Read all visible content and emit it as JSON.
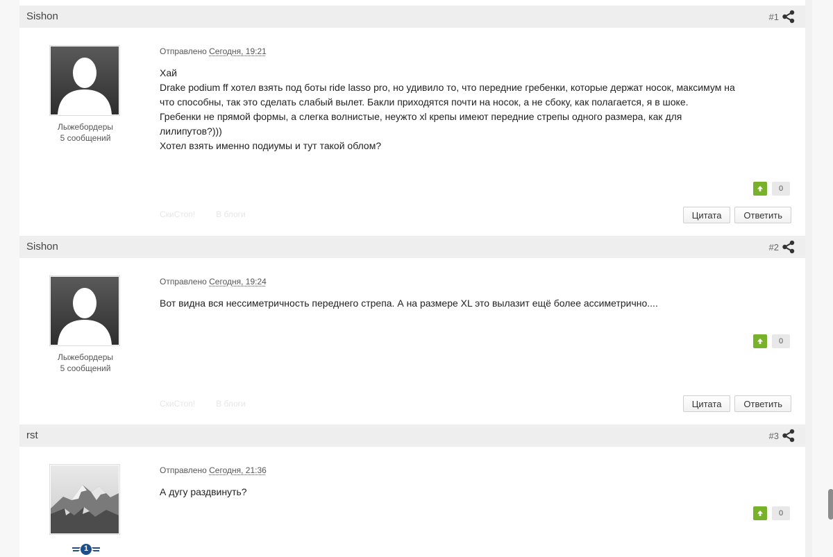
{
  "posts": [
    {
      "author": "Sishon",
      "number": "#1",
      "meta_label": "Отправлено",
      "date": "Сегодня, 19:21",
      "group": "Лыжебордеры",
      "post_count": "5 сообщений",
      "lines": [
        "Хай",
        "Drake podium ff хотел взять под боты ride lasso pro, но удивило то, что передние гребенки, которые держат носок, максимум на",
        "что способны, так это сделать слабый вылет. Бакли приходятся почти на носок, а не сбоку, как полагается, я в шоке.",
        "Гребенки не прямой формы, а слегка волнистые, неужто xl крепы имеют передние стрепы одного размера, как для",
        "лилипутов?)))",
        "Хотел взять именно подиумы и тут такой облом?"
      ],
      "votes": "0",
      "link_blog": "СкиСтоп!",
      "link_in_blog": "В блоги",
      "quote_label": "Цитата",
      "reply_label": "Ответить"
    },
    {
      "author": "Sishon",
      "number": "#2",
      "meta_label": "Отправлено",
      "date": "Сегодня, 19:24",
      "group": "Лыжебордеры",
      "post_count": "5 сообщений",
      "lines": [
        "Вот видна вся нессиметричность переднего стрепа. А на размере XL это вылазит ещё более ассиметрично...."
      ],
      "votes": "0",
      "link_blog": "СкиСтоп!",
      "link_in_blog": "В блоги",
      "quote_label": "Цитата",
      "reply_label": "Ответить"
    },
    {
      "author": "rst",
      "number": "#3",
      "meta_label": "Отправлено",
      "date": "Сегодня, 21:36",
      "lines": [
        "А дугу раздвинуть?"
      ],
      "votes": "0",
      "rank": "1"
    }
  ],
  "icons": {
    "share": "share-icon",
    "vote_up": "arrow-up-icon",
    "avatar_default": "default-avatar-icon",
    "avatar_mountain": "mountain-avatar",
    "rank": "rank-wings-badge"
  },
  "colors": {
    "vote_up": "#78b22a",
    "header_bg": "#eeeeee"
  }
}
